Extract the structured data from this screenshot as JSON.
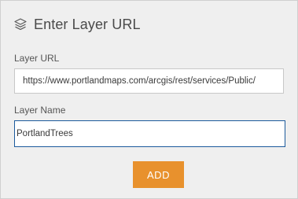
{
  "dialog": {
    "title": "Enter Layer URL",
    "header_icon": "layers-icon"
  },
  "fields": {
    "layer_url": {
      "label": "Layer URL",
      "value": "https://www.portlandmaps.com/arcgis/rest/services/Public/"
    },
    "layer_name": {
      "label": "Layer Name",
      "value": "PortlandTrees"
    }
  },
  "actions": {
    "add_label": "ADD"
  },
  "colors": {
    "accent": "#e8912d",
    "focus_border": "#1c5a9c",
    "panel_bg": "#efefef"
  }
}
